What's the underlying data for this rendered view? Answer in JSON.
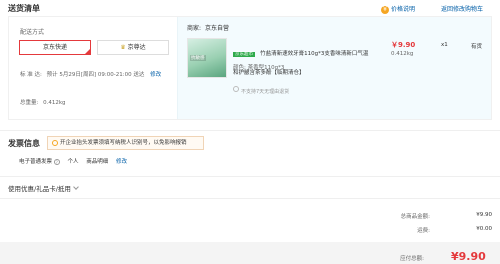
{
  "header": {
    "title": "送货清单",
    "price_note_label": "价格说明",
    "back_link_label": "返回修改购物车"
  },
  "delivery": {
    "method_label": "配送方式",
    "option_jd": "京东快递",
    "option_jingzhunda": "京尊达",
    "time_label": "标  准  达:",
    "time_value": "预计 5月29日[周四] 09:00-21:00 送达",
    "modify_label": "修改",
    "total_weight_label": "总重量:",
    "total_weight_value": "0.412kg"
  },
  "store": {
    "seller_label": "商家:",
    "seller_name": "京东自营",
    "product": {
      "thumb_label": "抗敏感",
      "tag": "京东超市",
      "name": "竹盐清新速效牙膏110g*3支香味清新口气温和护龈含茶多酚【临期清仓】",
      "color": "颜色: 茶香型110g*3",
      "price": "￥9.90",
      "weight": "0.412kg",
      "qty": "x1",
      "stock": "有货",
      "return_note": "不支持7天无理由退货"
    }
  },
  "invoice": {
    "title": "发票信息",
    "tip": "开企业抬头发票须填写纳税人识别号，以免影响报销",
    "type": "电子普通发票",
    "help_icon": "?",
    "holder": "个人",
    "content": "商品明细",
    "modify_label": "修改"
  },
  "coupon": {
    "title": "使用优惠/礼品卡/抵用"
  },
  "totals": {
    "goods_label": "总商品金额:",
    "goods_value": "¥9.90",
    "shipping_label": "运费:",
    "shipping_value": "¥0.00",
    "pay_label": "应付总额:",
    "pay_value": "¥9.90"
  },
  "colors": {
    "accent_red": "#e4393c",
    "link_blue": "#005ea7",
    "store_bg": "#f3fbfe",
    "tag_green": "#2eaa4b"
  },
  "icons": [
    "price-info-icon",
    "crown-icon",
    "selected-corner-icon",
    "return-info-icon",
    "tip-icon",
    "help-icon",
    "chevron-down-icon"
  ]
}
